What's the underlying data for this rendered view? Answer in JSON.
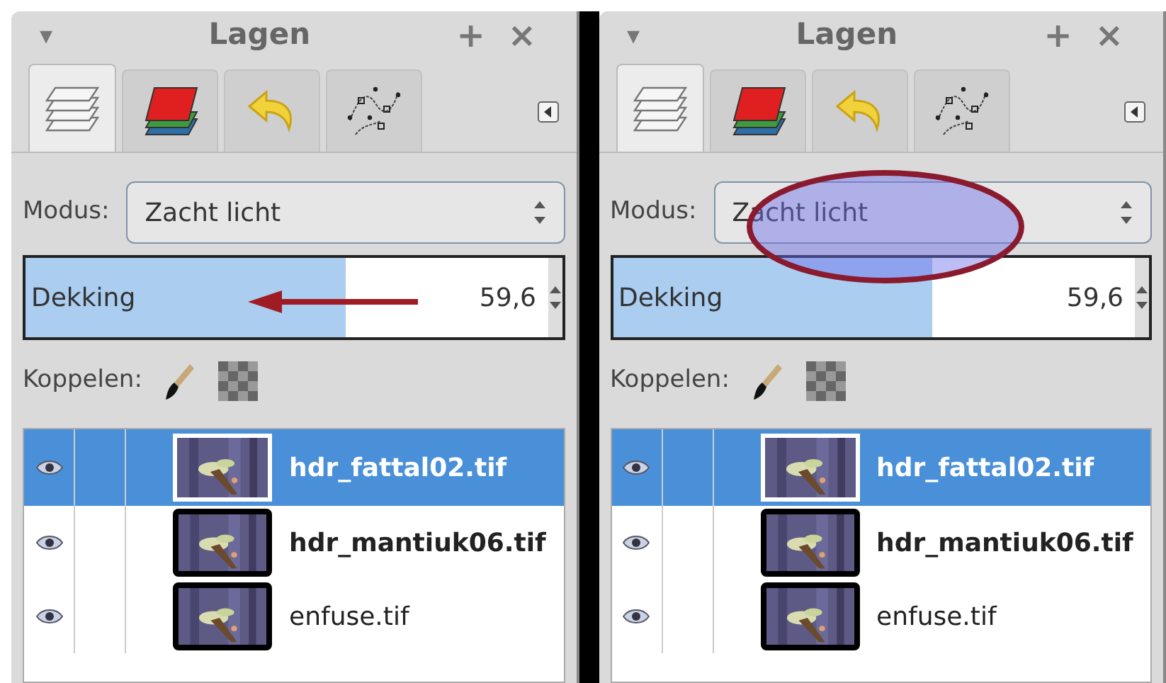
{
  "panels": [
    {
      "title": "Lagen",
      "menu_glyph": "▾",
      "add_glyph": "+",
      "close_glyph": "×",
      "tabs": [
        {
          "kind": "layers",
          "selected": true
        },
        {
          "kind": "channels",
          "selected": false
        },
        {
          "kind": "undo",
          "selected": false
        },
        {
          "kind": "paths",
          "selected": false
        }
      ],
      "mode": {
        "label": "Modus:",
        "value": "Zacht licht"
      },
      "opacity": {
        "label": "Dekking",
        "value": "59,6",
        "level": 0.596
      },
      "annotation": {
        "kind": "arrow"
      },
      "lock_label": "Koppelen:",
      "layers": [
        {
          "name": "hdr_fattal02.tif",
          "selected": true,
          "bold": true
        },
        {
          "name": "hdr_mantiuk06.tif",
          "selected": false,
          "bold": true
        },
        {
          "name": "enfuse.tif",
          "selected": false,
          "bold": false
        }
      ]
    },
    {
      "title": "Lagen",
      "menu_glyph": "▾",
      "add_glyph": "+",
      "close_glyph": "×",
      "tabs": [
        {
          "kind": "layers",
          "selected": true
        },
        {
          "kind": "channels",
          "selected": false
        },
        {
          "kind": "undo",
          "selected": false
        },
        {
          "kind": "paths",
          "selected": false
        }
      ],
      "mode": {
        "label": "Modus:",
        "value": "Zacht licht"
      },
      "opacity": {
        "label": "Dekking",
        "value": "59,6",
        "level": 0.596
      },
      "annotation": {
        "kind": "ellipse"
      },
      "lock_label": "Koppelen:",
      "layers": [
        {
          "name": "hdr_fattal02.tif",
          "selected": true,
          "bold": true
        },
        {
          "name": "hdr_mantiuk06.tif",
          "selected": false,
          "bold": true
        },
        {
          "name": "enfuse.tif",
          "selected": false,
          "bold": false
        }
      ]
    }
  ]
}
